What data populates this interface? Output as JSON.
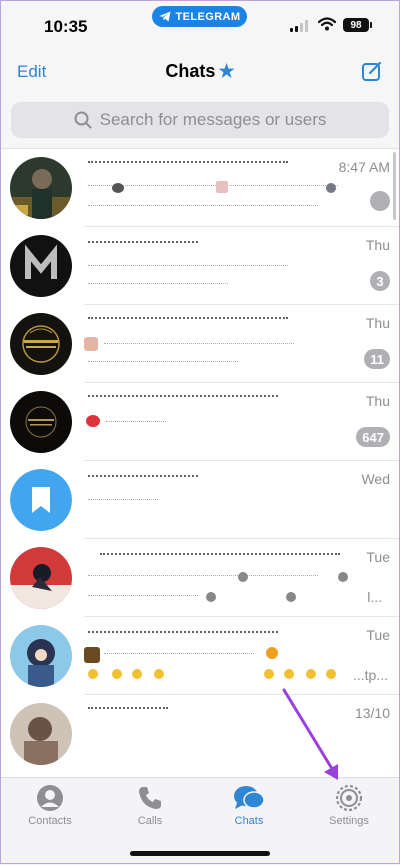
{
  "status_bar": {
    "time": "10:35",
    "app_pill": "TELEGRAM",
    "battery": "98"
  },
  "nav": {
    "edit": "Edit",
    "title": "Chats",
    "title_icon": "star-icon",
    "compose_icon": "compose-icon"
  },
  "search": {
    "placeholder": "Search for messages or users"
  },
  "chats": [
    {
      "time": "8:47 AM",
      "badge": "",
      "avatar": "photo-man-dark"
    },
    {
      "time": "Thu",
      "badge": "3",
      "avatar": "letter-m-logo"
    },
    {
      "time": "Thu",
      "badge": "11",
      "avatar": "drama-nova-logo"
    },
    {
      "time": "Thu",
      "badge": "647",
      "avatar": "dark-gold-logo"
    },
    {
      "time": "Wed",
      "badge": "",
      "avatar": "saved-messages-bookmark"
    },
    {
      "time": "Tue",
      "badge": "",
      "ellipsis": "l...",
      "avatar": "anime-red"
    },
    {
      "time": "Tue",
      "badge": "",
      "ellipsis": "...tp...",
      "avatar": "anime-blue"
    },
    {
      "time": "13/10",
      "badge": "",
      "avatar": "photo-blurred"
    }
  ],
  "tabs": [
    {
      "label": "Contacts",
      "icon": "person-icon"
    },
    {
      "label": "Calls",
      "icon": "phone-icon"
    },
    {
      "label": "Chats",
      "icon": "chat-bubbles-icon",
      "active": true
    },
    {
      "label": "Settings",
      "icon": "gear-icon"
    }
  ],
  "colors": {
    "accent": "#2f86d6",
    "annotation_arrow": "#9b3fe0",
    "badge": "#b0b0b4"
  }
}
